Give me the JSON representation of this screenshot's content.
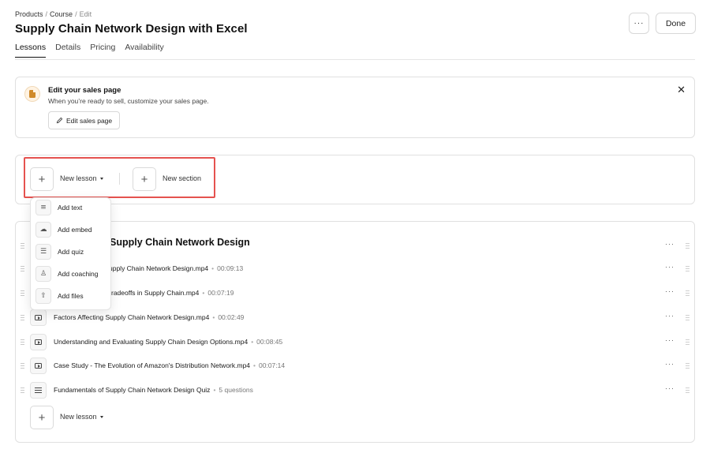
{
  "breadcrumb": {
    "products": "Products",
    "course": "Course",
    "edit": "Edit",
    "separator": "/"
  },
  "page_title": "Supply Chain Network Design with Excel",
  "header": {
    "more_label": "···",
    "done_label": "Done"
  },
  "tabs": [
    {
      "label": "Lessons",
      "active": true
    },
    {
      "label": "Details",
      "active": false
    },
    {
      "label": "Pricing",
      "active": false
    },
    {
      "label": "Availability",
      "active": false
    }
  ],
  "sales_banner": {
    "title": "Edit your sales page",
    "description": "When you’re ready to sell, customize your sales page.",
    "button_label": "Edit sales page",
    "close_label": "✕"
  },
  "actions": {
    "new_lesson_label": "New lesson",
    "new_section_label": "New section",
    "plus": "+"
  },
  "dropdown": {
    "items": [
      {
        "label": "Add text",
        "icon": "text-lines-icon"
      },
      {
        "label": "Add embed",
        "icon": "cloud-icon"
      },
      {
        "label": "Add quiz",
        "icon": "quiz-list-icon"
      },
      {
        "label": "Add coaching",
        "icon": "person-icon"
      },
      {
        "label": "Add files",
        "icon": "file-upload-icon"
      }
    ]
  },
  "section": {
    "title": "Supply Chain Network Design",
    "lessons": [
      {
        "title": "upply Chain Network Design.mp4",
        "meta": "00:09:13",
        "type": "video"
      },
      {
        "title": "radeoffs in Supply Chain.mp4",
        "meta": "00:07:19",
        "type": "video"
      },
      {
        "title": "Factors Affecting Supply Chain Network Design.mp4",
        "meta": "00:02:49",
        "type": "video"
      },
      {
        "title": "Understanding and Evaluating Supply Chain Design Options.mp4",
        "meta": "00:08:45",
        "type": "video"
      },
      {
        "title": "Case Study - The Evolution of Amazon's Distribution Network.mp4",
        "meta": "00:07:14",
        "type": "video"
      },
      {
        "title": "Fundamentals of Supply Chain Network Design Quiz",
        "meta": "5 questions",
        "type": "quiz"
      }
    ],
    "row_more": "···",
    "new_lesson_label": "New lesson"
  },
  "colors": {
    "highlight": "#e5524f",
    "badge_bg": "#fff3e3",
    "badge_icon": "#d08a2a"
  }
}
